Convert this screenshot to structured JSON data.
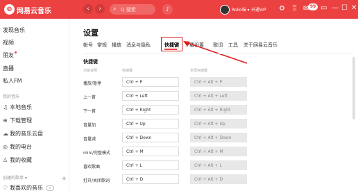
{
  "topbar": {
    "app_name": "网易云音乐",
    "back_glyph": "‹",
    "forward_glyph": "›",
    "search_icon": "search-icon",
    "search_placeholder": "Q 搜索",
    "mic_icon": "microphone-icon",
    "username": "Rollo喵 ▾",
    "vip_label": "开通VIP",
    "message_badge": "99",
    "accent_color": "#ec4141"
  },
  "sidebar": {
    "items": [
      {
        "label": "发现音乐"
      },
      {
        "label": "视频"
      },
      {
        "label": "朋友"
      },
      {
        "label": "直播"
      },
      {
        "label": "私人FM"
      }
    ],
    "section_my_music": "我的音乐",
    "my_items": [
      {
        "icon": "♫",
        "label": "本地音乐"
      },
      {
        "icon": "⊕",
        "label": "下载管理"
      },
      {
        "icon": "☁",
        "label": "我的音乐云盘"
      },
      {
        "icon": "◎",
        "label": "我的电台"
      },
      {
        "icon": "♙",
        "label": "我的收藏"
      }
    ],
    "section_playlists": "创建的歌单 ▾",
    "plus_glyph": "+",
    "liked_playlist": "我喜欢的音乐"
  },
  "main": {
    "title": "设置",
    "tabs": [
      "帐号",
      "常规",
      "播放",
      "消息与隐私",
      "快捷键",
      "下载设置",
      "歌词",
      "工具",
      "关于网易云音乐"
    ],
    "active_tab_index": 4,
    "section_title": "快捷键",
    "col_function": "功能说明",
    "col_local": "快捷键",
    "col_global": "全局快捷键",
    "rows": [
      {
        "label": "播放/暂停",
        "local": "Ctrl + P",
        "global": "Ctrl + Alt + P"
      },
      {
        "label": "上一首",
        "local": "Ctrl + Left",
        "global": "Ctrl + Alt + Left"
      },
      {
        "label": "下一首",
        "local": "Ctrl + Right",
        "global": "Ctrl + Alt + Right"
      },
      {
        "label": "音量加",
        "local": "Ctrl + Up",
        "global": "Ctrl + Alt + Up"
      },
      {
        "label": "音量减",
        "local": "Ctrl + Down",
        "global": "Ctrl + Alt + Down"
      },
      {
        "label": "mini/完整模式",
        "local": "Ctrl + M",
        "global": "Ctrl + Alt + M"
      },
      {
        "label": "喜欢歌曲",
        "local": "Ctrl + L",
        "global": "Ctrl + Alt + L"
      },
      {
        "label": "打开/关闭歌词",
        "local": "Ctrl + D",
        "global": "Ctrl + Alt + D"
      }
    ]
  }
}
